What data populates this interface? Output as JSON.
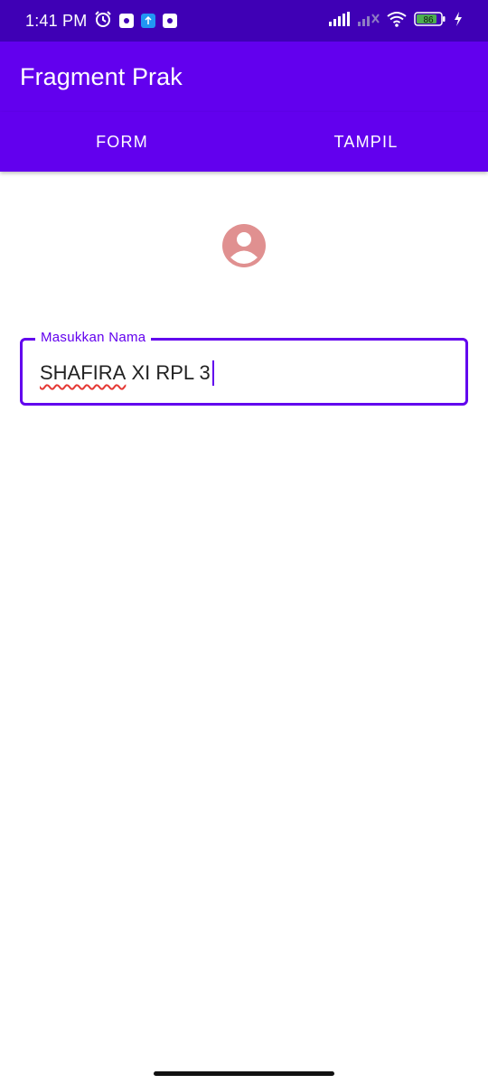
{
  "status_bar": {
    "time": "1:41 PM",
    "icons": [
      "alarm-icon",
      "app-notification-icon",
      "upload-icon",
      "app-notification-icon",
      "signal-icon",
      "signal-no-sim-icon",
      "wifi-icon",
      "battery-icon",
      "charging-icon"
    ],
    "battery_level": "86",
    "color": "#3f00b5"
  },
  "app_bar": {
    "title": "Fragment Prak",
    "color": "#6200ee"
  },
  "tabs": [
    {
      "label": "FORM",
      "selected": true
    },
    {
      "label": "TAMPIL",
      "selected": false
    }
  ],
  "form": {
    "avatar_icon": "account-circle-icon",
    "avatar_color": "#e09090",
    "name_field": {
      "label": "Masukkan Nama",
      "value_misspelled_word": "SHAFIRA",
      "value_rest": " XI RPL 3"
    }
  }
}
